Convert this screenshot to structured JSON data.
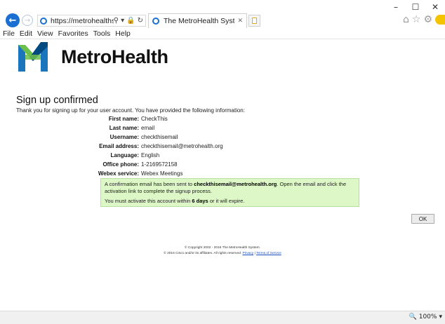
{
  "browser": {
    "window_controls": {
      "minimize": "–",
      "maximize": "☐",
      "close": "✕"
    },
    "back_glyph": "←",
    "forward_glyph": "→",
    "address": "https://metrohealthsy...",
    "address_icons": {
      "search": "⚲",
      "dropdown": "▾",
      "lock": "🔒",
      "refresh": "↻"
    },
    "tab_title": "The MetroHealth System W...",
    "tab_close": "✕",
    "right_icons": {
      "home": "⌂",
      "favorites": "☆",
      "settings": "⚙"
    },
    "menu": [
      "File",
      "Edit",
      "View",
      "Favorites",
      "Tools",
      "Help"
    ],
    "zoom": "100%",
    "zoom_icon": "🔍",
    "zoom_dropdown": "▾"
  },
  "brand": {
    "name": "MetroHealth",
    "colors": {
      "green": "#6dbf4b",
      "blue": "#1b75bc",
      "dark": "#004a80"
    }
  },
  "page": {
    "title": "Sign up confirmed",
    "intro": "Thank you for signing up for your user account. You have provided the following information:",
    "fields": [
      {
        "label": "First name:",
        "value": "CheckThis"
      },
      {
        "label": "Last name:",
        "value": "email"
      },
      {
        "label": "Username:",
        "value": "checkthisemail"
      },
      {
        "label": "Email address:",
        "value": "checkthisemail@metrohealth.org"
      },
      {
        "label": "Language:",
        "value": "English"
      },
      {
        "label": "Office phone:",
        "value": "1-2169572158"
      },
      {
        "label": "Webex service:",
        "value": "Webex Meetings"
      }
    ],
    "notice": {
      "line1_pre": "A confirmation email has been sent to ",
      "line1_email": "checkthisemail@metrohealth.org",
      "line1_post": ". Open the email and click the activation link to complete the signup process.",
      "line2_pre": "You must activate this account within ",
      "line2_days": "6 days",
      "line2_post": " or it will expire."
    },
    "ok_label": "OK",
    "footer": {
      "copyright": "© Copyright 2002 - 2016 The MetroHealth System.",
      "cisco": "© 2016 Cisco and/or its affiliates. All rights reserved.",
      "privacy": "Privacy",
      "separator": "|",
      "terms": "Terms of Service"
    }
  }
}
